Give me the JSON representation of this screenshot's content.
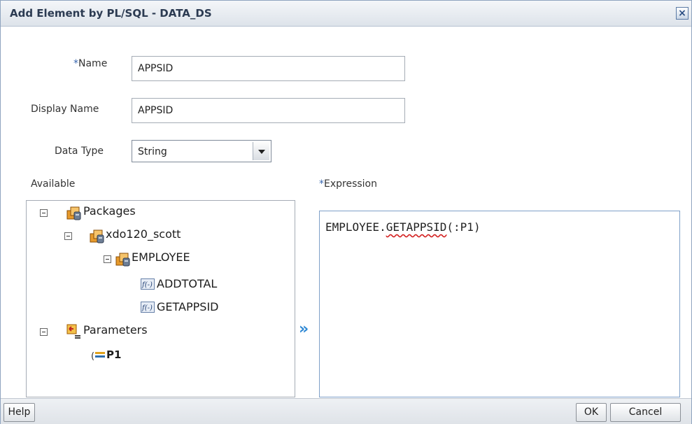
{
  "dialog": {
    "title": "Add Element by PL/SQL - DATA_DS",
    "close_label": "×"
  },
  "form": {
    "name": {
      "required_mark": "*",
      "label": "Name",
      "value": "APPSID"
    },
    "display_name": {
      "label": "Display Name",
      "value": "APPSID"
    },
    "data_type": {
      "label": "Data Type",
      "value": "String"
    }
  },
  "available": {
    "label": "Available",
    "tree": {
      "packages": "Packages",
      "schema": "xdo120_scott",
      "package": "EMPLOYEE",
      "functions": [
        "ADDTOTAL",
        "GETAPPSID"
      ],
      "parameters": "Parameters",
      "parameter_items": [
        "P1"
      ]
    }
  },
  "expression": {
    "required_mark": "*",
    "label": "Expression",
    "prefix": "EMPLOYEE.",
    "func": "GETAPPSID",
    "suffix": "(:P1)"
  },
  "move_arrow": "»",
  "footer": {
    "help_label": "Help",
    "ok_label": "OK",
    "cancel_label": "Cancel"
  },
  "colors": {
    "title_text": "#2c3b52",
    "required_marker": "#3a68b0",
    "expression_border": "#7fa0c8",
    "move_arrow": "#2e88d4",
    "squiggle": "#d32020"
  },
  "icons": {
    "package": "package-icon",
    "function": "function-icon",
    "parameters": "parameters-icon",
    "parameter": "parameter-icon",
    "tree_toggle": "collapse-toggle-icon"
  }
}
